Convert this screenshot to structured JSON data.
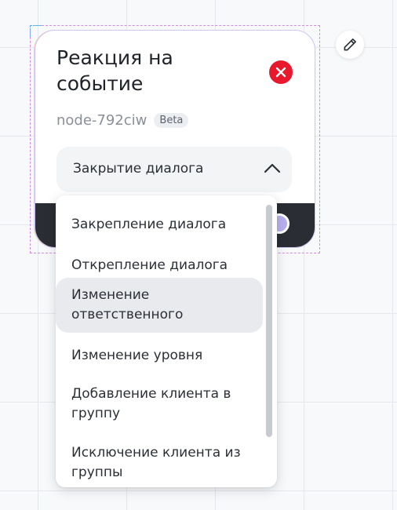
{
  "node": {
    "title": "Реакция на событие",
    "id": "node-792ciw",
    "badge": "Beta"
  },
  "select": {
    "value": "Закрытие диалога",
    "expanded": true
  },
  "dropdown": {
    "options": [
      "Закрепление диалога",
      "Открепление диалога",
      "Изменение ответственного",
      "Изменение уровня",
      "Добавление клиента в группу",
      "Исключение клиента из группы"
    ],
    "highlighted_index": 2
  },
  "icons": {
    "edit": "pencil-icon",
    "close": "close-icon",
    "chevron": "chevron-up-icon"
  },
  "colors": {
    "close_button": "#e8192c",
    "footer": "#2a2d34",
    "card_border": "#cdc5f2",
    "selection_frame": "#d58ae0"
  }
}
